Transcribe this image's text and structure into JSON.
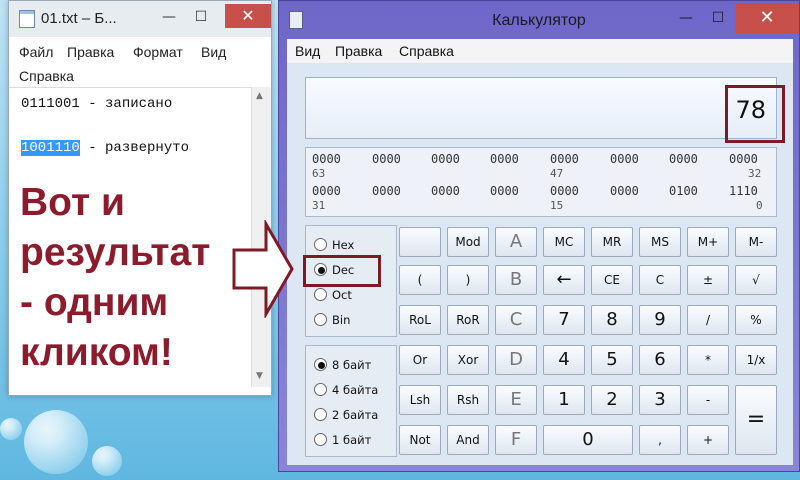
{
  "notepad": {
    "title": "01.txt – Б...",
    "controls": {
      "minimize": "—",
      "maximize": "☐",
      "close": "✕"
    },
    "menu": [
      "Файл",
      "Правка",
      "Формат",
      "Вид",
      "Справка"
    ],
    "line1": "0111001 - записано",
    "line3_selected": "1001110",
    "line3_rest": " - развернуто",
    "overlay": [
      "Вот и",
      "результат",
      "- одним",
      "кликом!"
    ]
  },
  "calculator": {
    "title": "Калькулятор",
    "controls": {
      "minimize": "—",
      "maximize": "☐",
      "close": "✕"
    },
    "menu": [
      "Вид",
      "Правка",
      "Справка"
    ],
    "display": "78",
    "bits_row1": [
      "0000",
      "0000",
      "0000",
      "0000",
      "0000",
      "0000",
      "0000",
      "0000"
    ],
    "bits_row1_pos": [
      "63",
      "47",
      "32"
    ],
    "bits_row2": [
      "0000",
      "0000",
      "0000",
      "0000",
      "0000",
      "0000",
      "0100",
      "1110"
    ],
    "bits_row2_pos": [
      "31",
      "15",
      "0"
    ],
    "radix": [
      {
        "label": "Hex",
        "selected": false
      },
      {
        "label": "Dec",
        "selected": true
      },
      {
        "label": "Oct",
        "selected": false
      },
      {
        "label": "Bin",
        "selected": false
      }
    ],
    "word": [
      {
        "label": "8 байт",
        "selected": true
      },
      {
        "label": "4 байта",
        "selected": false
      },
      {
        "label": "2 байта",
        "selected": false
      },
      {
        "label": "1 байт",
        "selected": false
      }
    ],
    "keys": {
      "blank": "",
      "mod": "Mod",
      "a": "A",
      "mc": "MC",
      "mr": "MR",
      "ms": "MS",
      "mplus": "M+",
      "mminus": "M-",
      "lparen": "(",
      "rparen": ")",
      "b": "B",
      "back": "←",
      "ce": "CE",
      "c": "C",
      "plusminus": "±",
      "sqrt": "√",
      "rol": "RoL",
      "ror": "RoR",
      "cc": "C",
      "n7": "7",
      "n8": "8",
      "n9": "9",
      "div": "/",
      "pct": "%",
      "or": "Or",
      "xor": "Xor",
      "d": "D",
      "n4": "4",
      "n5": "5",
      "n6": "6",
      "mul": "*",
      "recip": "1/x",
      "lsh": "Lsh",
      "rsh": "Rsh",
      "e": "E",
      "n1": "1",
      "n2": "2",
      "n3": "3",
      "sub": "-",
      "eq": "=",
      "not": "Not",
      "and": "And",
      "f": "F",
      "n0": "0",
      "dot": ",",
      "add": "+"
    }
  }
}
